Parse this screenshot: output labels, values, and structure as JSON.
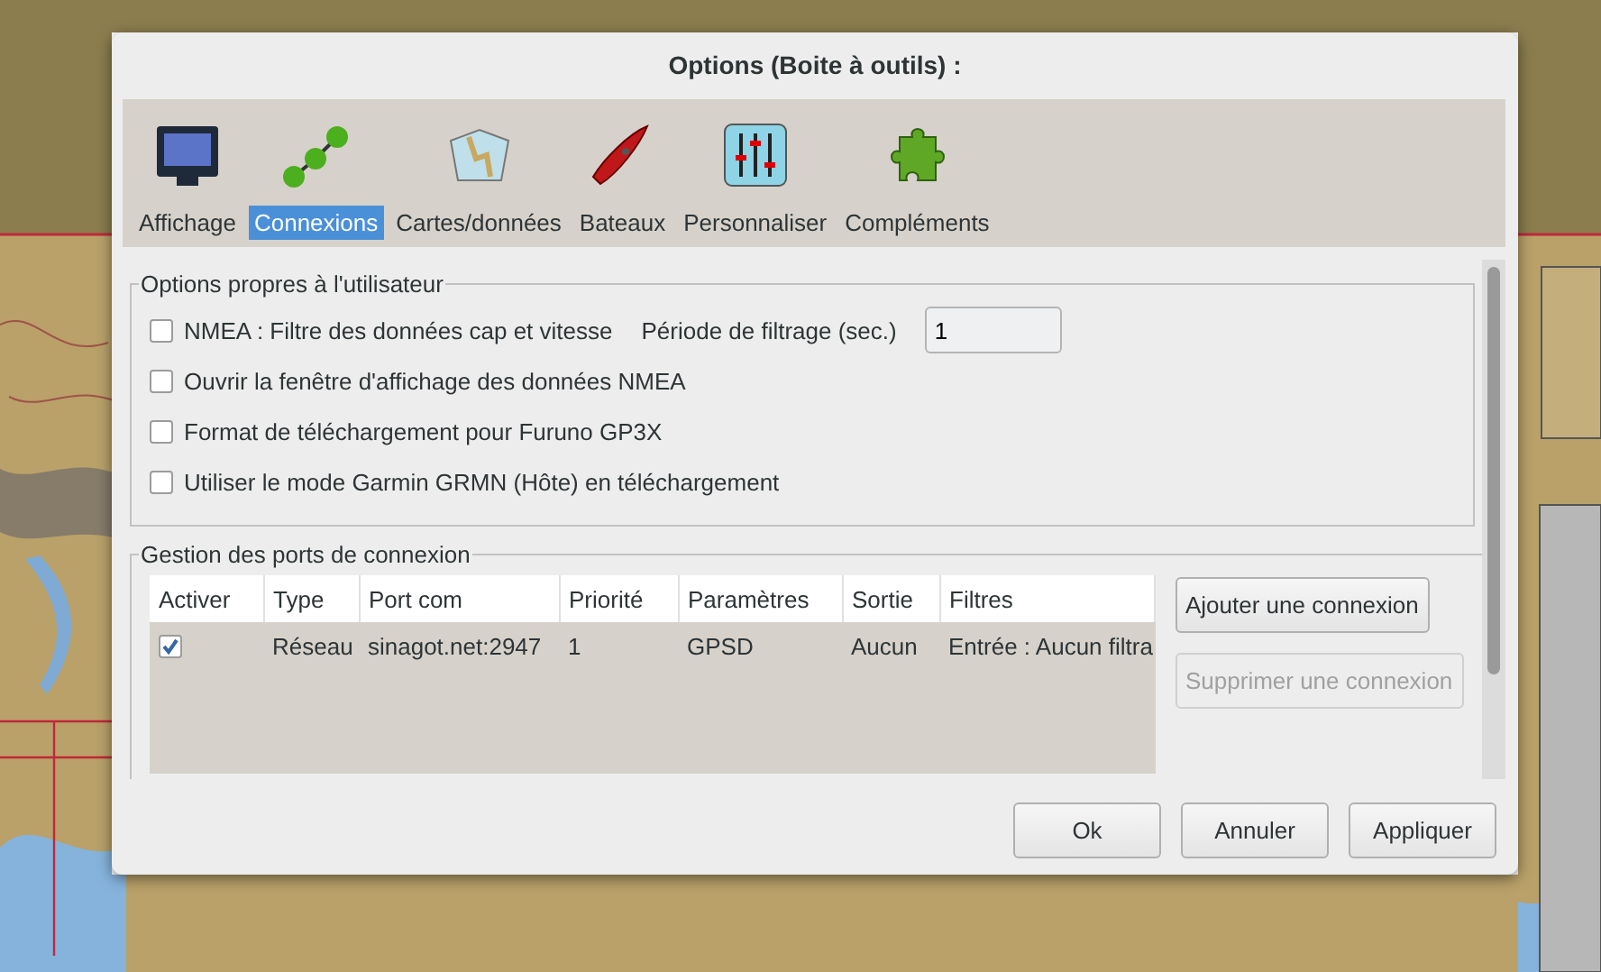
{
  "window": {
    "title": "Options (Boite à outils) :"
  },
  "tabs": [
    {
      "label": "Affichage",
      "kind": "monitor",
      "selected": false
    },
    {
      "label": "Connexions",
      "kind": "nodes",
      "selected": true
    },
    {
      "label": "Cartes/données",
      "kind": "charts",
      "selected": false
    },
    {
      "label": "Bateaux",
      "kind": "boat",
      "selected": false
    },
    {
      "label": "Personnaliser",
      "kind": "sliders",
      "selected": false
    },
    {
      "label": "Compléments",
      "kind": "puzzle",
      "selected": false
    }
  ],
  "user_options": {
    "title": "Options propres à l'utilisateur",
    "checks": [
      {
        "label": "NMEA : Filtre des données cap et vitesse",
        "checked": false
      },
      {
        "label": "Ouvrir la fenêtre d'affichage des données NMEA",
        "checked": false
      },
      {
        "label": "Format de téléchargement pour Furuno GP3X",
        "checked": false
      },
      {
        "label": "Utiliser le mode Garmin GRMN (Hôte) en téléchargement",
        "checked": false
      }
    ],
    "filter_period": {
      "label": "Période de filtrage (sec.)",
      "value": "1"
    }
  },
  "ports": {
    "title": "Gestion des ports de connexion",
    "columns": [
      "Activer",
      "Type",
      "Port com",
      "Priorité",
      "Paramètres",
      "Sortie",
      "Filtres"
    ],
    "rows": [
      {
        "checked": true,
        "cells": [
          "",
          "Réseau",
          "sinagot.net:2947",
          "1",
          "GPSD",
          "Aucun",
          "Entrée : Aucun filtra"
        ]
      }
    ],
    "buttons": [
      {
        "label": "Ajouter une connexion",
        "disabled": false
      },
      {
        "label": "Supprimer une connexion",
        "disabled": true
      }
    ]
  },
  "footer_buttons": [
    "Ok",
    "Annuler",
    "Appliquer"
  ]
}
